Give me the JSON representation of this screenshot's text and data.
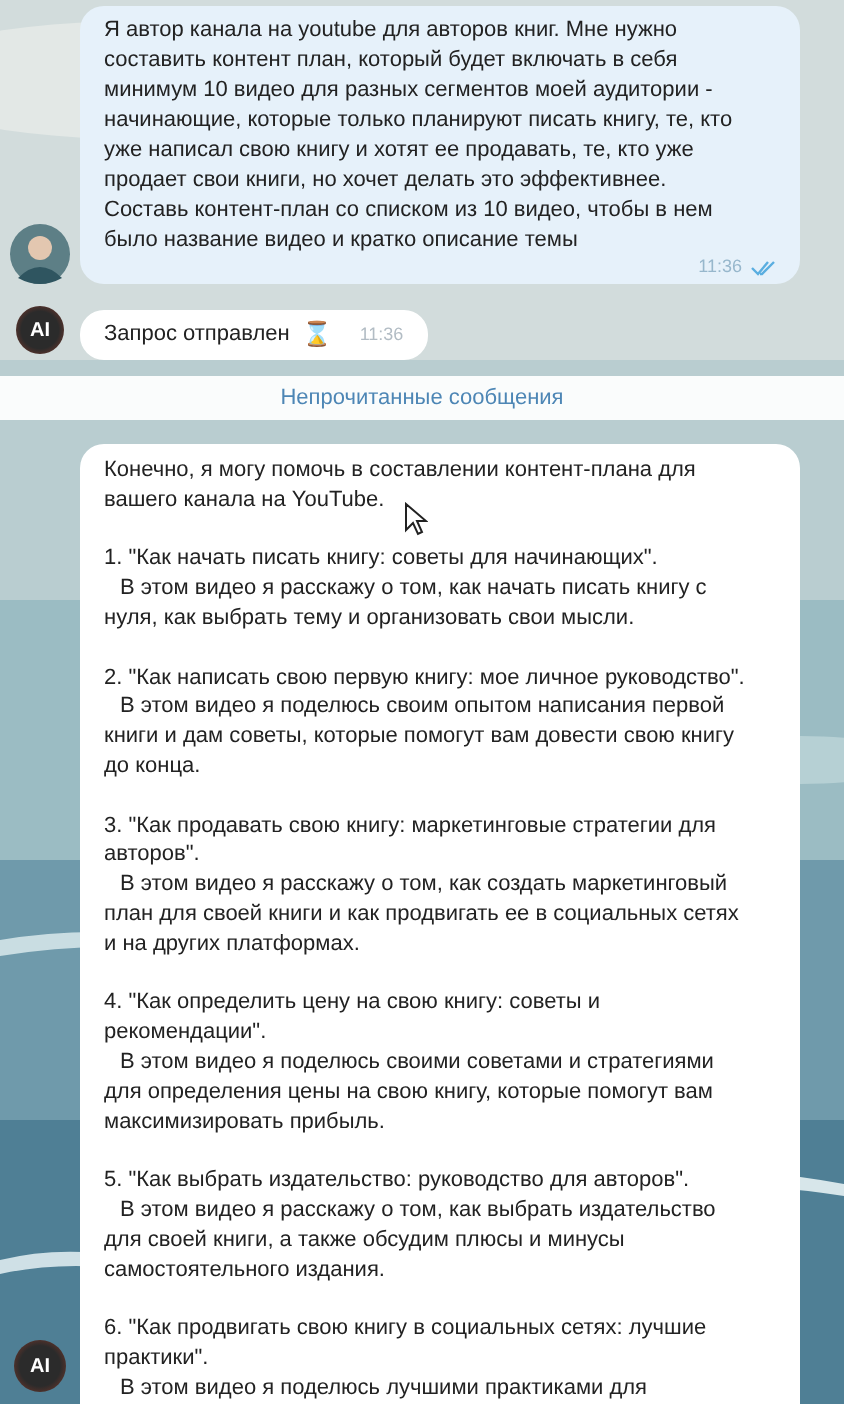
{
  "messages": [
    {
      "kind": "outgoing",
      "paragraphs": [
        "Я автор канала на youtube для авторов книг. Мне нужно составить контент план, который будет включать в себя минимум 10 видео для разных сегментов моей аудитории - начинающие, которые только планируют писать книгу, те, кто уже написал свою книгу и хотят ее продавать, те, кто уже продает свои книги, но хочет делать это эффективнее.",
        "Составь контент-план со списком из 10 видео, чтобы в нем было название видео и кратко описание темы"
      ],
      "time": "11:36",
      "read": true
    },
    {
      "kind": "incoming",
      "avatar": {
        "kind": "logo",
        "text": "AI"
      },
      "paragraphs": [
        "Запрос отправлен"
      ],
      "status_icon": "⌛",
      "time": "11:36"
    }
  ],
  "unread_divider": "Непрочитанные сообщения",
  "reply": {
    "avatar": {
      "kind": "logo",
      "text": "AI"
    },
    "intro": "Конечно, я могу помочь в составлении контент-плана для вашего канала на YouTube.",
    "items": [
      {
        "title": "1. \"Как начать писать книгу: советы для начинающих\".",
        "description": "В этом видео я расскажу о том, как начать писать книгу с нуля, как выбрать тему и организовать свои мысли."
      },
      {
        "title": "2. \"Как написать свою первую книгу: мое личное руководство\".",
        "description": "В этом видео я поделюсь своим опытом написания первой книги и дам советы, которые помогут вам довести свою книгу до конца."
      },
      {
        "title": "3. \"Как продавать свою книгу: маркетинговые стратегии для авторов\".",
        "description": "В этом видео я расскажу о том, как создать маркетинговый план для своей книги и как продвигать ее в социальных сетях и на других платформах."
      },
      {
        "title": "4. \"Как определить цену на свою книгу: советы и рекомендации\".",
        "description": "В этом видео я поделюсь своими советами и стратегиями для определения цены на свою книгу, которые помогут вам максимизировать прибыль."
      },
      {
        "title": "5. \"Как выбрать издательство: руководство для авторов\".",
        "description": "В этом видео я расскажу о том, как выбрать издательство для своей книги, а также обсудим плюсы и минусы самостоятельного издания."
      },
      {
        "title": "6. \"Как продвигать свою книгу в социальных сетях: лучшие практики\".",
        "description": "В этом видео я поделюсь лучшими практиками для"
      }
    ]
  }
}
